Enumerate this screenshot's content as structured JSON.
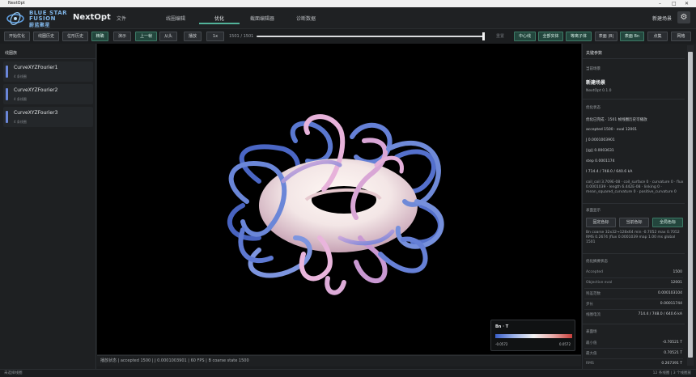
{
  "window": {
    "title": "NextOpt",
    "controls": [
      "–",
      "□",
      "✕"
    ]
  },
  "header": {
    "logo_text_en": "BLUE STAR FUSION",
    "logo_text_cn": "蔚蓝聚星",
    "app_name": "NextOpt",
    "tabs": [
      "文件",
      "线圈编辑",
      "优化",
      "截面编辑器",
      "诊断数据"
    ],
    "active_tab": "优化",
    "scene_name": "新建场景",
    "settings_icon": "gear-icon"
  },
  "toolbar": {
    "start_opt": "开始优化",
    "coil_history": "线圈历史",
    "pos_history": "位形历史",
    "fine": "精确",
    "demo": "演示",
    "prev_frame": "上一帧",
    "from_start": "从头",
    "play": "播放",
    "speed": "1x",
    "frame_counter": "1501 / 1501",
    "reset": "重置",
    "center_line": "中心线",
    "all_solid": "全部实体",
    "plasma": "等离子体",
    "surface_b": "表面 |B|",
    "surface_bn": "表面 Bn",
    "point_cloud": "点集",
    "grid": "网格",
    "frame_progress": 1.0
  },
  "left_panel": {
    "title": "线圈族",
    "coils": [
      {
        "name": "CurveXYZFourier1",
        "sub": "4 条线圈"
      },
      {
        "name": "CurveXYZFourier2",
        "sub": "4 条线圈"
      },
      {
        "name": "CurveXYZFourier3",
        "sub": "4 条线圈"
      }
    ],
    "accent": "#6a86d8"
  },
  "legend": {
    "title": "Bn · T",
    "min": "-0.0572",
    "max": "0.0572"
  },
  "viewport_status": "播放状态 | accepted 1500 | J 0.0001003901 | 60 FPS | B coarse state 1500",
  "right_panel": {
    "title": "关键参数",
    "scene_label": "当前场景",
    "scene_name": "新建场景",
    "version": "NextOpt 0.1.0",
    "opt_status_label": "优化状态",
    "opt_status_lines": [
      "优化已完成 · 1501 帧线圈历史可播放",
      "accepted 1500 · eval 12001",
      "J 0.0001003901",
      "||g|| 0.0003631",
      "step 0.0001174",
      "I 714.4 / 748.0 / 640.6 kA"
    ],
    "loss_line": "coil_coil 3.709E-08 · coil_surface 0 · curvature 0 · flux 0.0001039 · length 6.442E-08 · linking 0 · mean_squared_curvature 0 · positive_curvature 0",
    "surface_display_label": "表面显示",
    "surface_buttons": [
      "固定色标",
      "当前色标",
      "全局色标"
    ],
    "active_surface_button": "全局色标",
    "surface_info": "Bn coarse 32x32→128x64 min -0.7052 max 0.7052 RMS 0.2674 |flux 0.0001039 map 1.00 ms global 1501",
    "summary_label": "优化摘要状态",
    "summary": [
      {
        "key": "Accepted",
        "value": "1500"
      },
      {
        "key": "Objective eval",
        "value": "12001"
      },
      {
        "key": "残差范数",
        "value": "0.000103104"
      },
      {
        "key": "步长",
        "value": "0.00011744"
      },
      {
        "key": "线圈电流",
        "value": "714.4 / 748.0 / 640.6 kA"
      }
    ],
    "field_label": "表面场",
    "field": [
      {
        "key": "最小值",
        "value": "-0.70521 T"
      },
      {
        "key": "最大值",
        "value": "0.70521 T"
      },
      {
        "key": "RMS",
        "value": "0.267391 T"
      }
    ]
  },
  "statusbar": {
    "left": "未选择线圈",
    "right": "12 条线圈 | 3 个线圈族"
  },
  "colors": {
    "accent_green": "#52b39a",
    "coil_pink": "#e8b0d8",
    "coil_blue": "#5a78d0",
    "background": "#1b1d1f"
  }
}
